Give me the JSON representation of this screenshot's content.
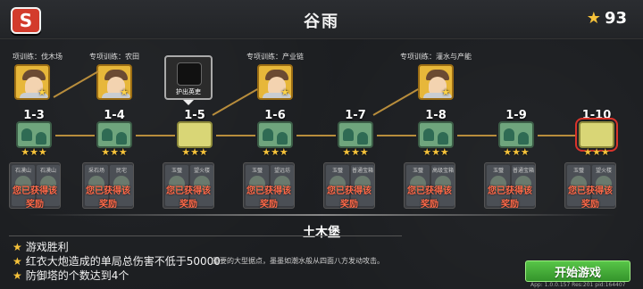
{
  "header": {
    "title": "谷雨",
    "star_count": "93",
    "back_icon_text": "S"
  },
  "trainers": [
    {
      "label": "项训练：伐木场"
    },
    {
      "label": "专项训练：农田"
    },
    {
      "label": "专项训练：产业链"
    },
    {
      "label": "专项训练：灌水与产能"
    }
  ],
  "boss": {
    "label": "护出英吏"
  },
  "levels": [
    {
      "id": "1-3"
    },
    {
      "id": "1-4"
    },
    {
      "id": "1-5"
    },
    {
      "id": "1-6"
    },
    {
      "id": "1-7"
    },
    {
      "id": "1-8"
    },
    {
      "id": "1-9"
    },
    {
      "id": "1-10"
    }
  ],
  "rewards": {
    "got_text": "您已获得该奖励",
    "cards": [
      {
        "a": "石漠山",
        "b": "石漠山"
      },
      {
        "a": "采石场",
        "b": "民宅"
      },
      {
        "a": "玉璧",
        "b": "望火楼"
      },
      {
        "a": "玉璧",
        "b": "望远坊"
      },
      {
        "a": "玉璧",
        "b": "普通宝箱"
      },
      {
        "a": "玉璧",
        "b": "高级宝箱"
      },
      {
        "a": "玉璧",
        "b": "普通宝箱"
      },
      {
        "a": "玉璧",
        "b": "望火楼"
      }
    ]
  },
  "stage": {
    "name": "土木堡",
    "objectives": [
      "游戏胜利",
      "红衣大炮造成的单局总伤害不低于50000",
      "防御塔的个数达到4个"
    ],
    "description": "重要的大型据点，墨墨如潮水般从四面八方发动攻击。"
  },
  "start_button": "开始游戏",
  "version": "App: 1.0.0.157 Res:201 pid:164407",
  "colors": {
    "accent_green": "#34942b",
    "star": "#f6c23a",
    "back_red": "#d33b2c"
  }
}
